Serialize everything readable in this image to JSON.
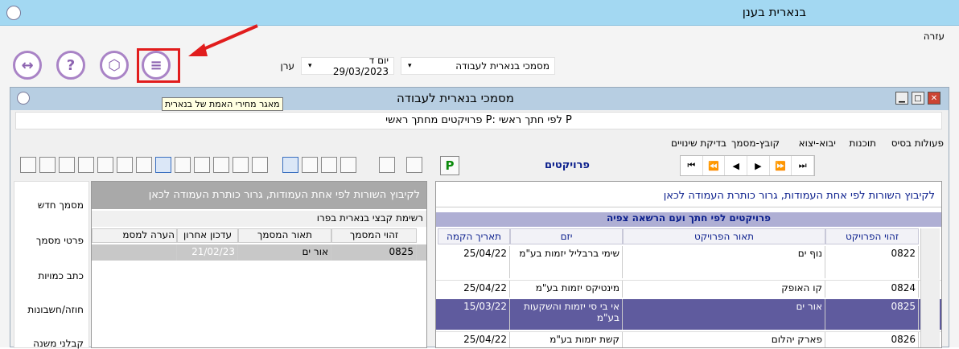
{
  "app": {
    "title": "בנארית בענן"
  },
  "menu": {
    "help": "עזרה"
  },
  "toolbar_top": {
    "icons": [
      "swap-icon",
      "help-icon",
      "package-icon",
      "price-list-icon"
    ],
    "date_combo": "יום ד 29/03/2023",
    "city_label": "ערן",
    "docs_combo": "מסמכי בנארית לעבודה"
  },
  "inner_window": {
    "title": "מסמכי בנארית לעבודה",
    "tooltip": "מאגר מחירי האמת של בנארית",
    "project_header": "פרויקטים מחתך ראשי P: לפי חתך ראשי P",
    "tabs": [
      "פעולות בסיס",
      "תוכנות",
      "יבוא-יצוא",
      "קובץ-מסמך",
      "בדיקת שינויים"
    ],
    "projects_label": "פרויקטים",
    "p_button": "P"
  },
  "right_panel": {
    "group_hint": "לקיבוץ השורות לפי אחת העמודות, גרור כותרת העמודה לכאן",
    "table_title": "פרויקטים לפי חתך ועם הרשאה צפיה",
    "columns": [
      "זהוי הפרויקט",
      "תאור הפרויקט",
      "יזם",
      "תאריך הקמה"
    ],
    "rows": [
      {
        "id": "0822",
        "desc": "נוף ים",
        "dev": "שימי ברבליל יזמות בע\"מ",
        "date": "25/04/22"
      },
      {
        "id": "0824",
        "desc": "קו האופק",
        "dev": "מינטיקס יזמות בע\"מ",
        "date": "25/04/22"
      },
      {
        "id": "0825",
        "desc": "אור ים",
        "dev": "אי בי סי יזמות והשקעות בע\"מ",
        "date": "15/03/22"
      },
      {
        "id": "0826",
        "desc": "פארק יהלום",
        "dev": "קשת יזמות בע\"מ",
        "date": "25/04/22"
      }
    ]
  },
  "left_panel": {
    "group_hint": "לקיבוץ השורות לפי אחת העמודות, גרור כותרת העמודה לכאן",
    "table_title": "רשימת קבצי בנארית בפרו",
    "columns": [
      "זהוי המסמך",
      "תאור המסמך",
      "עדכון אחרון",
      "הערה למסמ"
    ],
    "row": {
      "id": "0825",
      "desc": "אור ים",
      "updated": "21/02/23",
      "note": ""
    }
  },
  "sidebar": [
    "מסמך חדש",
    "פרטי מסמך",
    "כתב כמויות",
    "חוזה/חשבונות",
    "קבלני משנה"
  ],
  "colors": {
    "titlebar": "#a3d8f2",
    "selected_row": "#5f5b9e",
    "highlight": "#e11d1d"
  }
}
